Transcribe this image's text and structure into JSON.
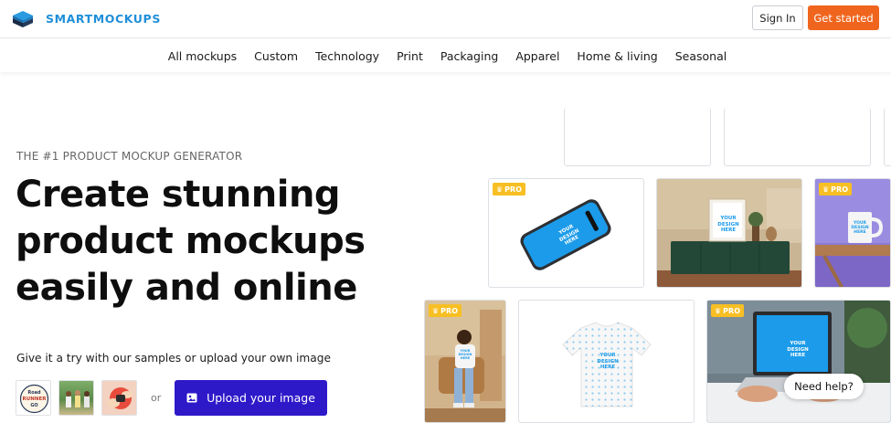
{
  "header": {
    "brand": "SMARTMOCKUPS",
    "sign_in": "Sign In",
    "get_started": "Get started"
  },
  "nav": {
    "items": [
      "All mockups",
      "Custom",
      "Technology",
      "Print",
      "Packaging",
      "Apparel",
      "Home & living",
      "Seasonal"
    ]
  },
  "hero": {
    "eyebrow": "THE #1 PRODUCT MOCKUP GENERATOR",
    "headline": [
      "Create stunning",
      "product mockups",
      "easily and online"
    ],
    "try_text": "Give it a try with our samples or upload your own image",
    "or": "or",
    "upload_label": "Upload your image",
    "sample_logo_text": [
      "Road",
      "RUNNER",
      "GO"
    ]
  },
  "gallery": {
    "pro_label": "PRO",
    "design_text": "YOUR DESIGN HERE"
  },
  "help": {
    "label": "Need help?"
  },
  "colors": {
    "brand": "#1f8fd8",
    "cta": "#f0651e",
    "upload": "#2e19c9",
    "pro_badge": "#f7bf23",
    "screen": "#1b9bea"
  },
  "icons": [
    "logo-cube-icon",
    "image-upload-icon",
    "crown-icon"
  ]
}
